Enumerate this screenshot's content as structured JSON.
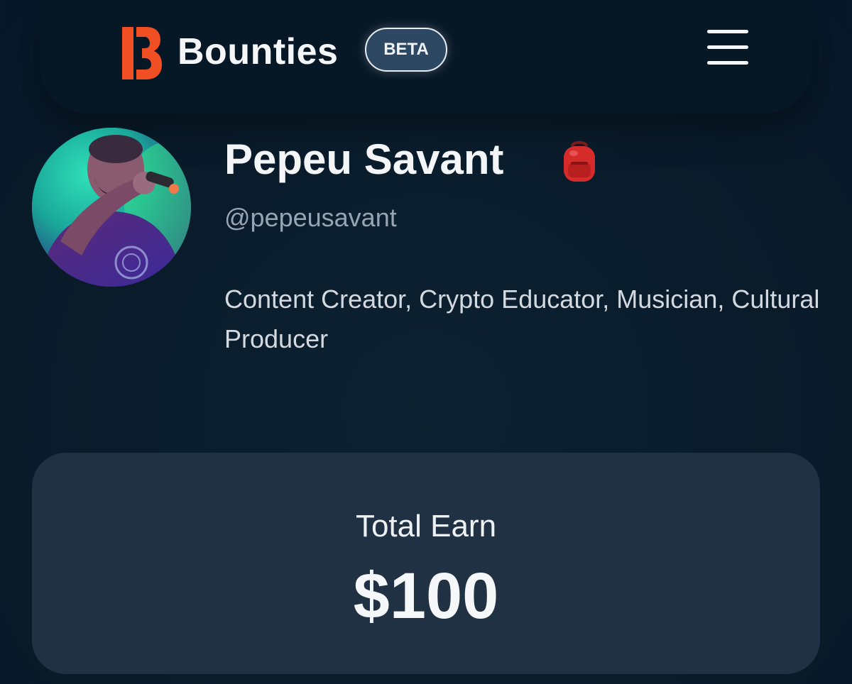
{
  "header": {
    "brand": "Bounties",
    "badge": "BETA",
    "logo_icon": "bounties-logo-icon",
    "menu_icon": "hamburger-menu-icon"
  },
  "profile": {
    "name": "Pepeu Savant",
    "name_emoji_icon": "backpack-icon",
    "handle": "@pepeusavant",
    "bio": "Content Creator, Crypto Educator, Musician, Cultural Producer"
  },
  "earnings": {
    "label": "Total Earn",
    "value": "$100"
  },
  "colors": {
    "background": "#0b1d2c",
    "header": "#061726",
    "card": "#1f3143",
    "brand_accent": "#f04e23",
    "badge_bg": "#2d4862",
    "handle_text": "#97a5b3"
  }
}
